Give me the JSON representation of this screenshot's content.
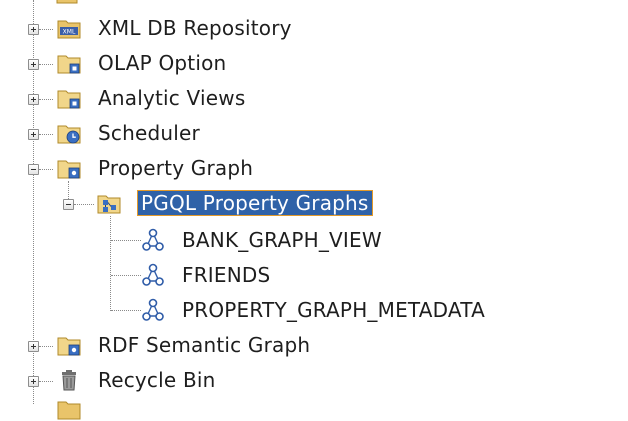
{
  "tree": {
    "nodes": [
      {
        "label": "XML DB Repository",
        "icon": "xml-folder-icon",
        "state": "collapsed"
      },
      {
        "label": "OLAP Option",
        "icon": "folder-icon",
        "state": "collapsed"
      },
      {
        "label": "Analytic Views",
        "icon": "folder-icon",
        "state": "collapsed"
      },
      {
        "label": "Scheduler",
        "icon": "scheduler-folder-icon",
        "state": "collapsed"
      },
      {
        "label": "Property Graph",
        "icon": "graph-folder-icon",
        "state": "expanded"
      },
      {
        "label": "PGQL Property Graphs",
        "icon": "pgql-folder-icon",
        "state": "expanded",
        "selected": true
      },
      {
        "label": "BANK_GRAPH_VIEW",
        "icon": "graph-icon",
        "state": "leaf"
      },
      {
        "label": "FRIENDS",
        "icon": "graph-icon",
        "state": "leaf"
      },
      {
        "label": "PROPERTY_GRAPH_METADATA",
        "icon": "graph-icon",
        "state": "leaf"
      },
      {
        "label": "RDF Semantic Graph",
        "icon": "graph-folder-icon",
        "state": "collapsed"
      },
      {
        "label": "Recycle Bin",
        "icon": "trash-icon",
        "state": "collapsed"
      }
    ]
  },
  "colors": {
    "selection_bg": "#2f62a8",
    "selection_border": "#e39a2a",
    "folder": "#e9c46a",
    "graph_icon": "#3a6fc2"
  }
}
